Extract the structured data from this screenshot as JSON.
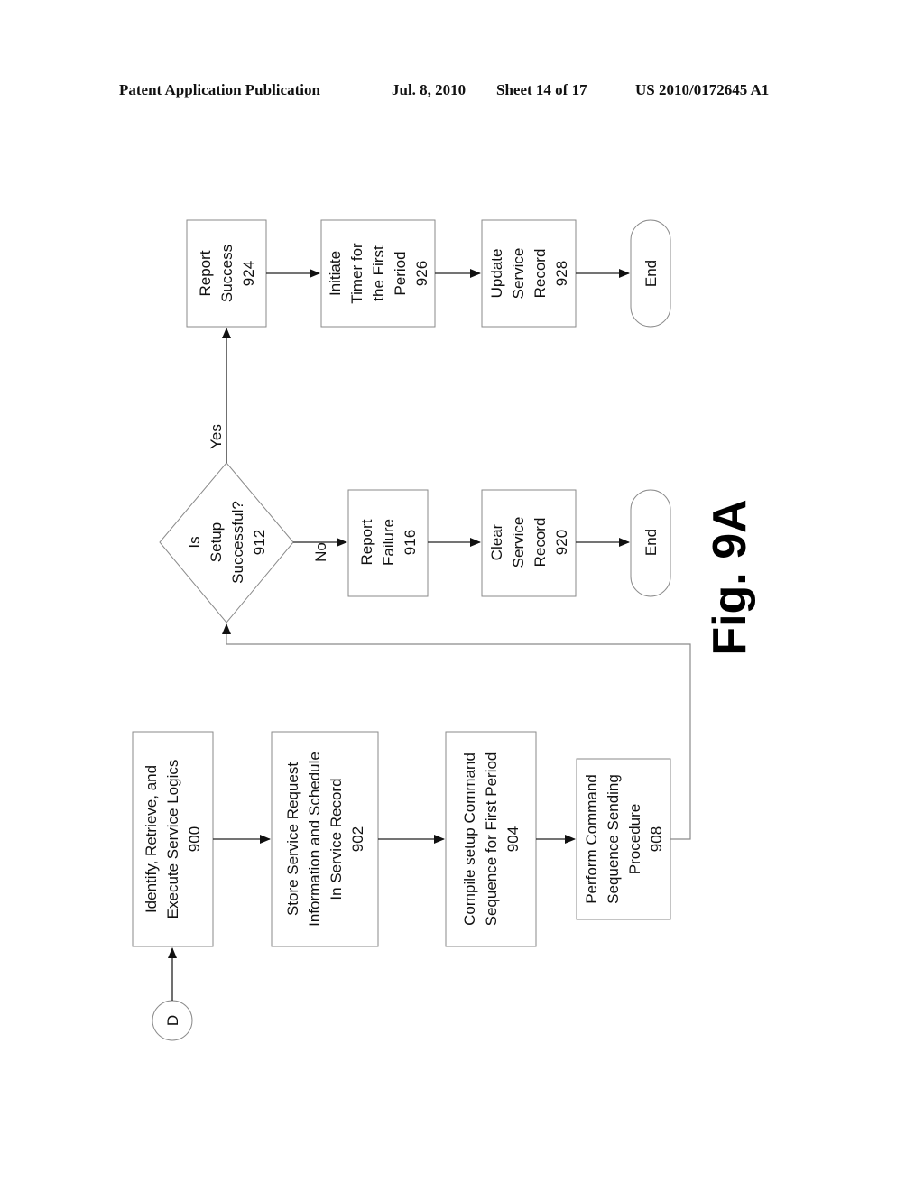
{
  "header": {
    "publication": "Patent Application Publication",
    "date": "Jul. 8, 2010",
    "sheet": "Sheet 14 of 17",
    "number": "US 2010/0172645 A1"
  },
  "figure": {
    "label": "Fig. 9A"
  },
  "connector": {
    "label": "D"
  },
  "nodes": {
    "n900": {
      "lines": [
        "Identify, Retrieve, and",
        "Execute Service Logics",
        "900"
      ]
    },
    "n902": {
      "lines": [
        "Store Service Request",
        "Information and Schedule",
        "In Service Record",
        "902"
      ]
    },
    "n904": {
      "lines": [
        "Compile setup Command",
        "Sequence for First Period",
        "904"
      ]
    },
    "n908": {
      "lines": [
        "Perform Command",
        "Sequence Sending",
        "Procedure",
        "908"
      ]
    },
    "n912": {
      "lines": [
        "Is",
        "Setup",
        "Successful?",
        "912"
      ]
    },
    "n916": {
      "lines": [
        "Report",
        "Failure",
        "916"
      ]
    },
    "n920": {
      "lines": [
        "Clear",
        "Service",
        "Record",
        "920"
      ]
    },
    "end1": {
      "lines": [
        "End"
      ]
    },
    "n924": {
      "lines": [
        "Report",
        "Success",
        "924"
      ]
    },
    "n926": {
      "lines": [
        "Initiate",
        "Timer for",
        "the First",
        "Period",
        "926"
      ]
    },
    "n928": {
      "lines": [
        "Update",
        "Service",
        "Record",
        "928"
      ]
    },
    "end2": {
      "lines": [
        "End"
      ]
    }
  },
  "edges": {
    "no_label": "No",
    "yes_label": "Yes"
  }
}
